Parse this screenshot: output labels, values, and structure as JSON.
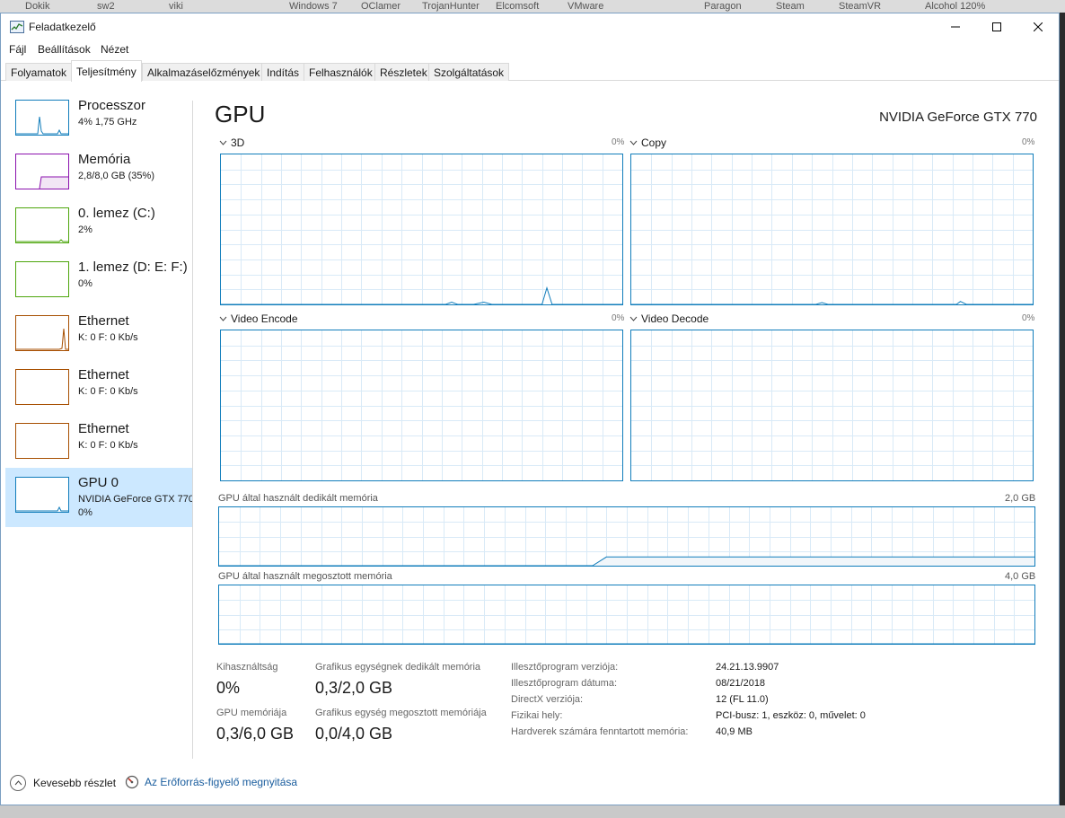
{
  "desktop": {
    "icons": [
      "Dokik",
      "sw2",
      "viki",
      "Windows 7",
      "OClamer",
      "TrojanHunter",
      "Elcomsoft",
      "VMware",
      "Paragon",
      "Steam",
      "SteamVR",
      "Alcohol 120%"
    ]
  },
  "window": {
    "title": "Feladatkezelő",
    "minimize_label": "–",
    "maximize_label": "☐",
    "close_label": "✕"
  },
  "menu": [
    "Fájl",
    "Beállítások",
    "Nézet"
  ],
  "tabs": [
    "Folyamatok",
    "Teljesítmény",
    "Alkalmazáselőzmények",
    "Indítás",
    "Felhasználók",
    "Részletek",
    "Szolgáltatások"
  ],
  "active_tab": "Teljesítmény",
  "sidebar": {
    "items": [
      {
        "name": "Processzor",
        "sub": "4% 1,75 GHz",
        "color": "#117dbb"
      },
      {
        "name": "Memória",
        "sub": "2,8/8,0 GB (35%)",
        "color": "#8b12ae"
      },
      {
        "name": "0. lemez (C:)",
        "sub": "2%",
        "color": "#4da60c"
      },
      {
        "name": "1. lemez (D: E: F:)",
        "sub": "0%",
        "color": "#4da60c"
      },
      {
        "name": "Ethernet",
        "sub": "K: 0 F: 0 Kb/s",
        "color": "#a74f01"
      },
      {
        "name": "Ethernet",
        "sub": "K: 0 F: 0 Kb/s",
        "color": "#a74f01"
      },
      {
        "name": "Ethernet",
        "sub": "K: 0 F: 0 Kb/s",
        "color": "#a74f01"
      },
      {
        "name": "GPU 0",
        "sub": "NVIDIA GeForce GTX 770",
        "sub2": "0%",
        "color": "#117dbb"
      }
    ]
  },
  "main": {
    "title": "GPU",
    "model": "NVIDIA GeForce GTX 770",
    "graphs": [
      {
        "label": "3D",
        "pct": "0%"
      },
      {
        "label": "Copy",
        "pct": "0%"
      },
      {
        "label": "Video Encode",
        "pct": "0%"
      },
      {
        "label": "Video Decode",
        "pct": "0%"
      }
    ],
    "dedicated_mem": {
      "label": "GPU által használt dedikált memória",
      "max": "2,0 GB"
    },
    "shared_mem": {
      "label": "GPU által használt megosztott memória",
      "max": "4,0 GB"
    },
    "stats": {
      "utilization_label": "Kihasználtság",
      "utilization_value": "0%",
      "dedicated_label": "Grafikus egységnek dedikált memória",
      "dedicated_value": "0,3/2,0 GB",
      "gpu_mem_label": "GPU memóriája",
      "gpu_mem_value": "0,3/6,0 GB",
      "shared_label": "Grafikus egység megosztott memóriája",
      "shared_value": "0,0/4,0 GB"
    },
    "info": [
      {
        "key": "Illesztőprogram verziója:",
        "value": "24.21.13.9907"
      },
      {
        "key": "Illesztőprogram dátuma:",
        "value": "08/21/2018"
      },
      {
        "key": "DirectX verziója:",
        "value": "12 (FL 11.0)"
      },
      {
        "key": "Fizikai hely:",
        "value": "PCI-busz: 1, eszköz: 0, művelet: 0"
      },
      {
        "key": "Hardverek számára fenntartott memória:",
        "value": "40,9 MB"
      }
    ]
  },
  "footer": {
    "fewer_details": "Kevesebb részlet",
    "resource_monitor": "Az Erőforrás-figyelő megnyitása"
  }
}
